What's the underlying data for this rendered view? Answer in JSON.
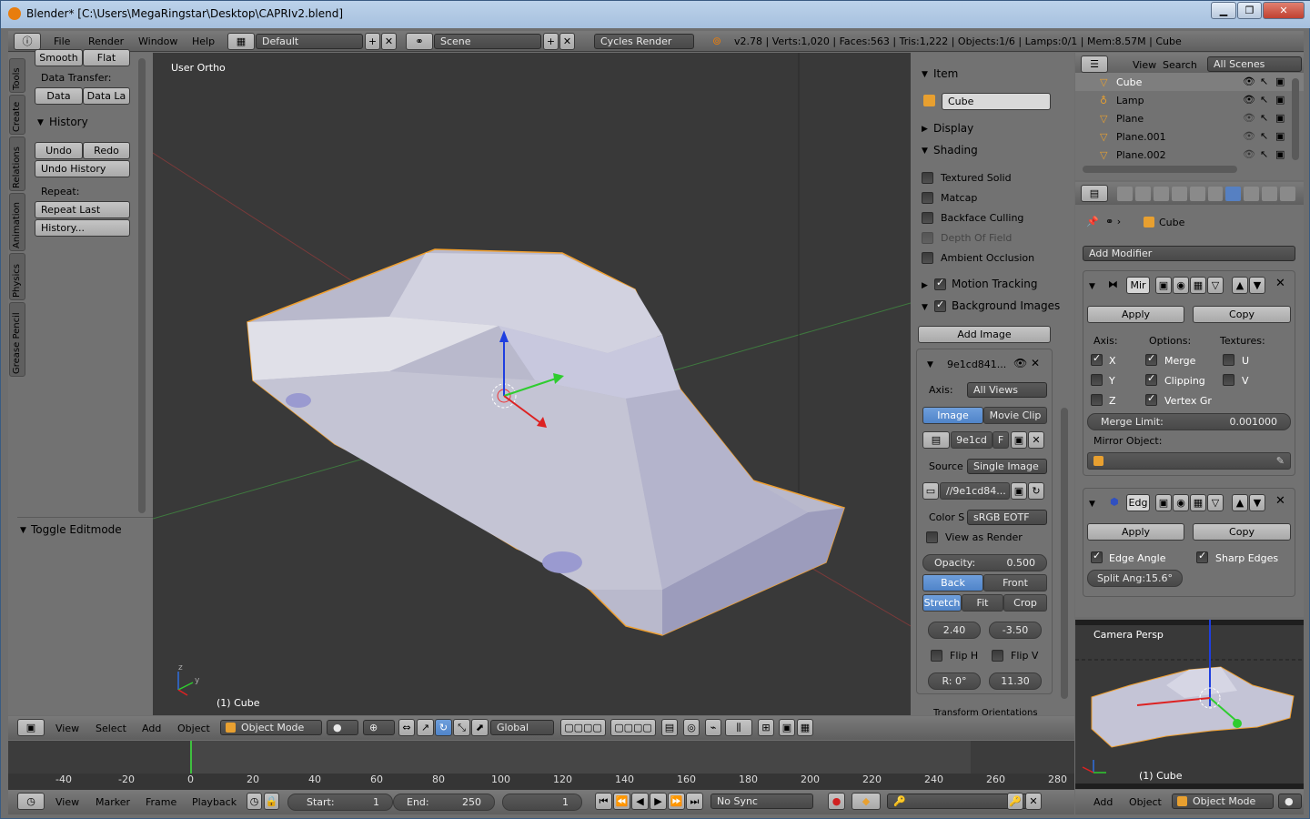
{
  "titlebar": {
    "title": "Blender* [C:\\Users\\MegaRingstar\\Desktop\\CAPRIv2.blend]",
    "min": "▁",
    "max": "❐",
    "close": "✕"
  },
  "topbar": {
    "menus": [
      "File",
      "Render",
      "Window",
      "Help"
    ],
    "layout": "Default",
    "scene": "Scene",
    "engine": "Cycles Render",
    "stats": "v2.78 | Verts:1,020 | Faces:563 | Tris:1,222 | Objects:1/6 | Lamps:0/1 | Mem:8.57M | Cube"
  },
  "tools": {
    "tabs": [
      "Tools",
      "Create",
      "Relations",
      "Animation",
      "Physics",
      "Grease Pencil"
    ],
    "smooth": "Smooth",
    "flat": "Flat",
    "data_transfer_label": "Data Transfer:",
    "data": "Data",
    "data_la": "Data La",
    "history_header": "History",
    "undo": "Undo",
    "redo": "Redo",
    "undo_history": "Undo History",
    "repeat_label": "Repeat:",
    "repeat_last": "Repeat Last",
    "history_btn": "History...",
    "toggle_editmode": "Toggle Editmode"
  },
  "viewport": {
    "view_name": "User Ortho",
    "object_label": "(1) Cube"
  },
  "props": {
    "item_header": "Item",
    "item_name": "Cube",
    "display_header": "Display",
    "shading_header": "Shading",
    "shading_options": [
      {
        "label": "Textured Solid",
        "on": false,
        "dim": false
      },
      {
        "label": "Matcap",
        "on": false,
        "dim": false
      },
      {
        "label": "Backface Culling",
        "on": false,
        "dim": false
      },
      {
        "label": "Depth Of Field",
        "on": false,
        "dim": true
      },
      {
        "label": "Ambient Occlusion",
        "on": false,
        "dim": false
      }
    ],
    "motion_tracking": "Motion Tracking",
    "background_images": "Background Images",
    "add_image": "Add Image",
    "bg_name": "9e1cd841...",
    "axis_label": "Axis:",
    "axis_value": "All Views",
    "image_tab": "Image",
    "movie_clip_tab": "Movie Clip",
    "img_name": "9e1cd",
    "img_f": "F",
    "source_label": "Source",
    "source_value": "Single Image",
    "filepath": "//9e1cd84...",
    "color_label": "Color S",
    "color_value": "sRGB EOTF",
    "view_as_render": "View as Render",
    "opacity_label": "Opacity:",
    "opacity_value": "0.500",
    "back": "Back",
    "front": "Front",
    "stretch": "Stretch",
    "fit": "Fit",
    "crop": "Crop",
    "offset_x": "2.40",
    "offset_y": "-3.50",
    "flip_h": "Flip H",
    "flip_v": "Flip V",
    "rotation": "R: 0°",
    "size": "11.30",
    "transform_orient": "Transform Orientations"
  },
  "outliner": {
    "view": "View",
    "search": "Search",
    "scenes": "All Scenes",
    "items": [
      {
        "name": "Cube",
        "selected": true
      },
      {
        "name": "Lamp",
        "selected": false
      },
      {
        "name": "Plane",
        "selected": false
      },
      {
        "name": "Plane.001",
        "selected": false
      },
      {
        "name": "Plane.002",
        "selected": false
      }
    ]
  },
  "modifiers": {
    "object_name": "Cube",
    "add_modifier": "Add Modifier",
    "mirror": {
      "name": "Mir",
      "apply": "Apply",
      "copy": "Copy",
      "axis_label": "Axis:",
      "options_label": "Options:",
      "textures_label": "Textures:",
      "x": "X",
      "y": "Y",
      "z": "Z",
      "merge": "Merge",
      "clipping": "Clipping",
      "vertex_gr": "Vertex Gr",
      "u": "U",
      "v": "V",
      "merge_limit_label": "Merge Limit:",
      "merge_limit_value": "0.001000",
      "mirror_object_label": "Mirror Object:"
    },
    "edge": {
      "name": "Edg",
      "apply": "Apply",
      "copy": "Copy",
      "edge_angle": "Edge Angle",
      "sharp_edges": "Sharp Edges",
      "split_angle": "Split Ang:15.6°"
    }
  },
  "camview": {
    "label": "Camera Persp",
    "object_label": "(1) Cube"
  },
  "vp3d_header": {
    "menus": [
      "View",
      "Select",
      "Add",
      "Object"
    ],
    "mode": "Object Mode",
    "orientation": "Global"
  },
  "timeline": {
    "ticks": [
      "-40",
      "-20",
      "0",
      "20",
      "40",
      "60",
      "80",
      "100",
      "120",
      "140",
      "160",
      "180",
      "200",
      "220",
      "240",
      "260",
      "280"
    ],
    "menus": [
      "View",
      "Marker",
      "Frame",
      "Playback"
    ],
    "start_label": "Start:",
    "start_value": "1",
    "end_label": "End:",
    "end_value": "250",
    "current": "1",
    "sync": "No Sync"
  },
  "right_bottom_header": {
    "add": "Add",
    "object": "Object",
    "mode": "Object Mode"
  },
  "colors": {
    "accent": "#5680c2",
    "selection": "#f0a030",
    "bg": "#393939"
  }
}
